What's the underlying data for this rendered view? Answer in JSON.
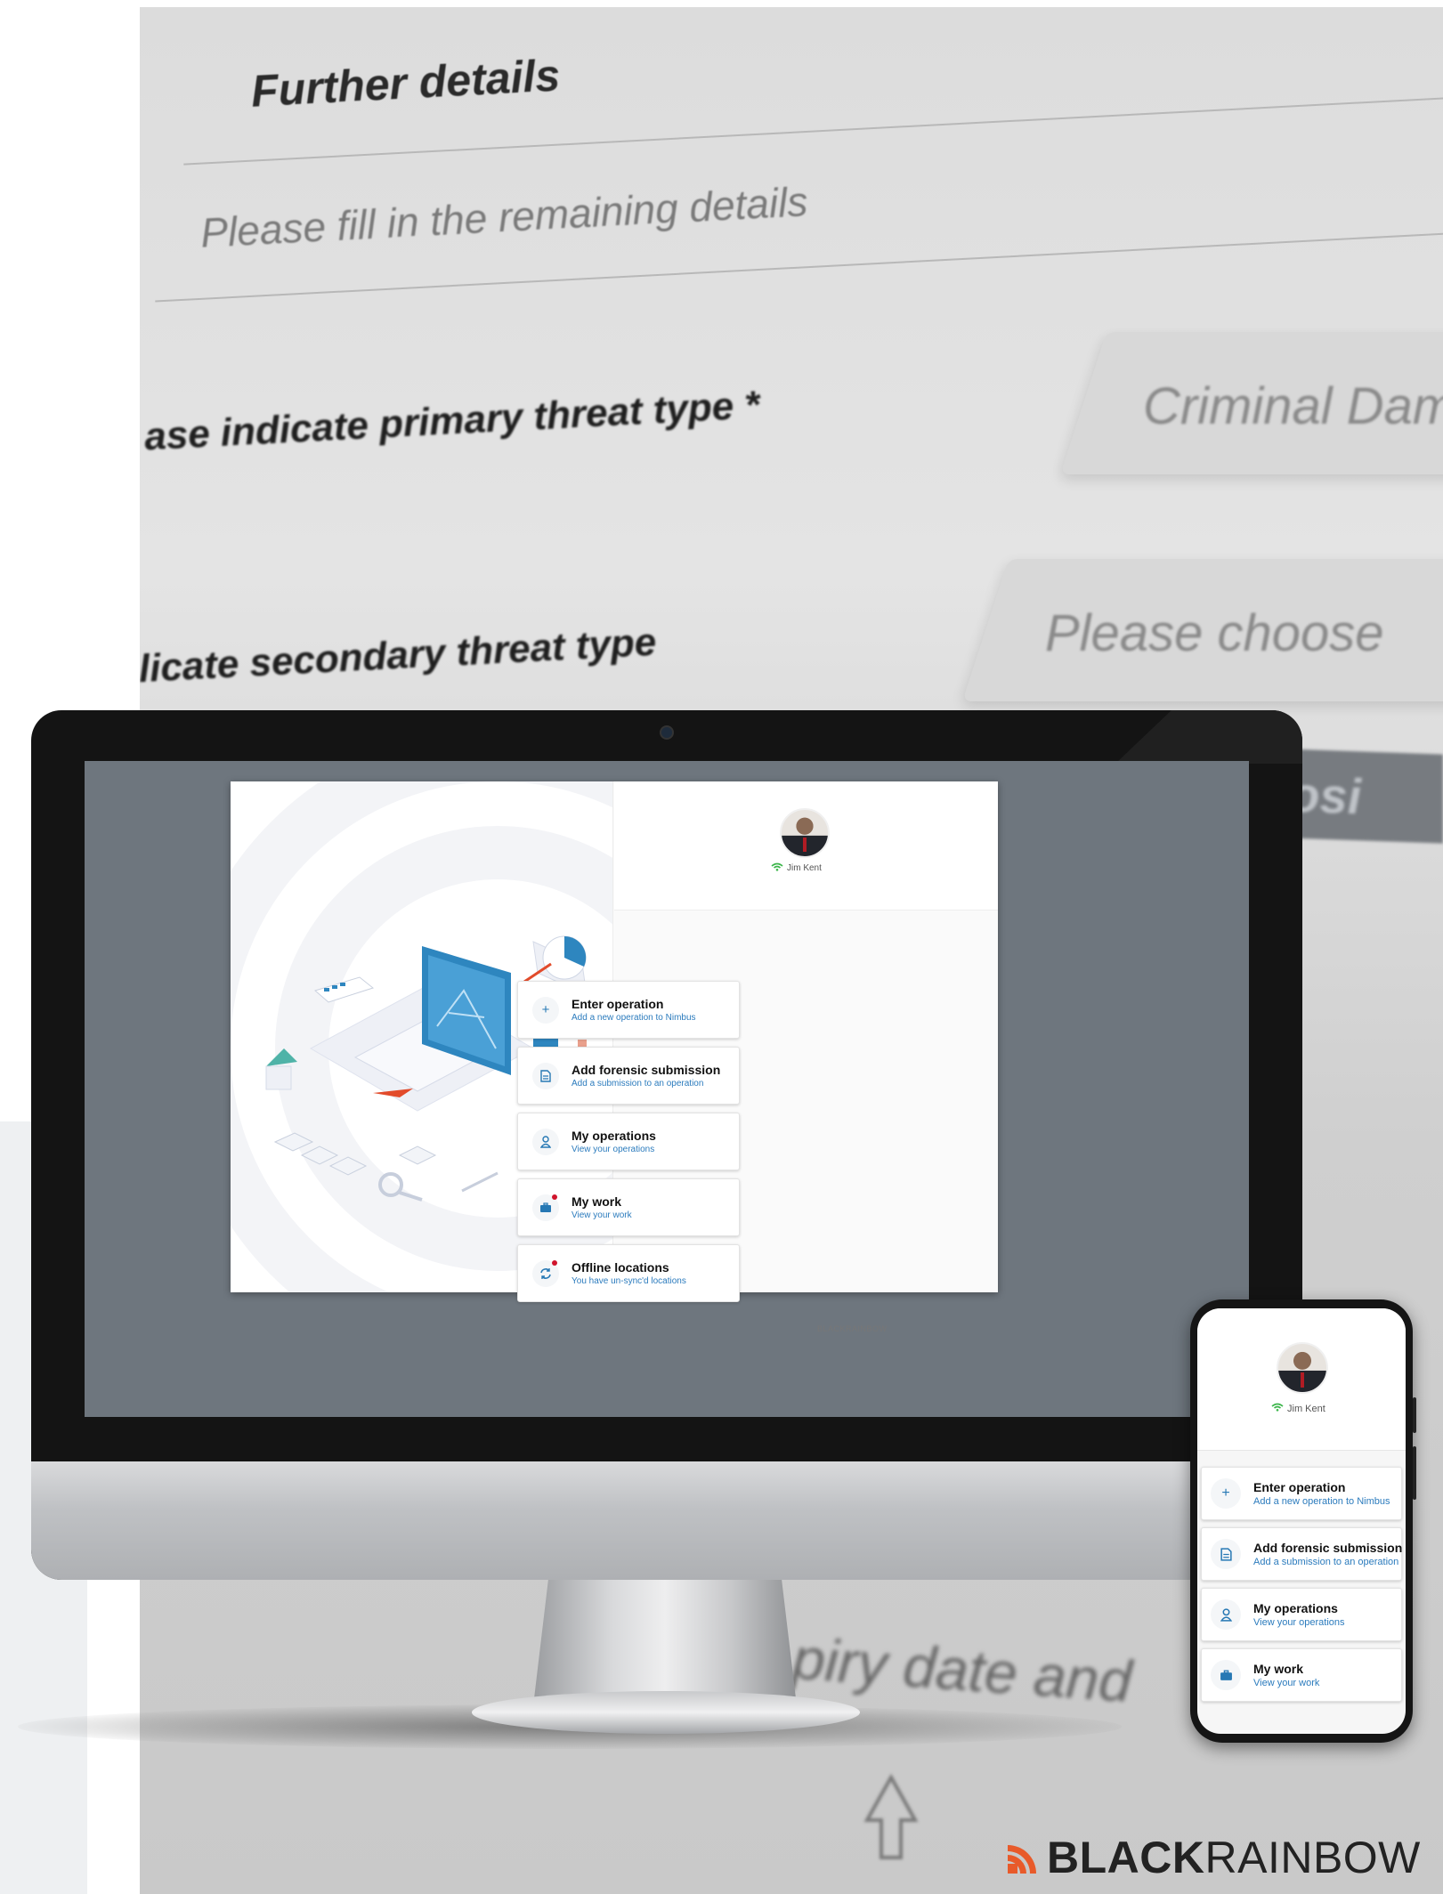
{
  "background_form": {
    "heading": "Further details",
    "subheading": "Please fill in the remaining details",
    "primary_label": "ase indicate primary threat type *",
    "primary_value": "Criminal Dama",
    "secondary_label": "licate secondary threat type",
    "secondary_value": "Please choose",
    "tab_text": "Explosi",
    "bottom_text": "piry date and"
  },
  "user": {
    "name": "Jim Kent"
  },
  "menu": [
    {
      "title": "Enter operation",
      "subtitle": "Add a new operation to Nimbus",
      "icon": "plus-icon"
    },
    {
      "title": "Add forensic submission",
      "subtitle": "Add a submission to an operation",
      "icon": "document-icon"
    },
    {
      "title": "My operations",
      "subtitle": "View your operations",
      "icon": "user-icon"
    },
    {
      "title": "My work",
      "subtitle": "View your work",
      "icon": "briefcase-icon",
      "notification": true
    },
    {
      "title": "Offline locations",
      "subtitle": "You have un-sync'd locations",
      "icon": "sync-icon",
      "notification": true
    }
  ],
  "brand": {
    "bold": "BLACK",
    "light": "RAINBOW",
    "small": "BLACKRAINBOW"
  },
  "colors": {
    "accent": "#2678b4",
    "notification": "#d0142c",
    "wifi": "#3bb54a",
    "brand_mark": "#e85a2a"
  }
}
